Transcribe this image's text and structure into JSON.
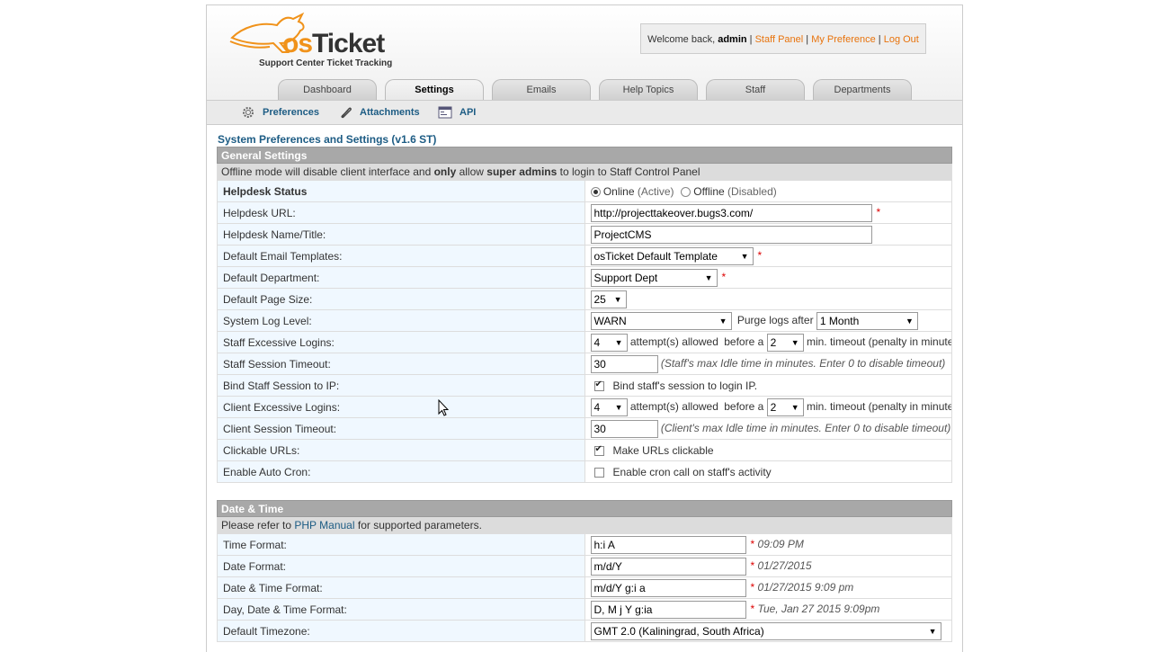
{
  "header": {
    "logo_os": "os",
    "logo_ticket": "Ticket",
    "logo_subtitle": "Support Center Ticket Tracking",
    "welcome_text": "Welcome back,",
    "username": "admin",
    "links": [
      "Staff Panel",
      "My Preference",
      "Log Out"
    ]
  },
  "tabs": [
    "Dashboard",
    "Settings",
    "Emails",
    "Help Topics",
    "Staff",
    "Departments"
  ],
  "active_tab": "Settings",
  "subnav": [
    "Preferences",
    "Attachments",
    "API"
  ],
  "page_title": "System Preferences and Settings  (v1.6 ST)",
  "general": {
    "heading": "General Settings",
    "info_pre": "Offline mode will disable client interface and ",
    "info_only": "only",
    "info_mid": " allow ",
    "info_super": "super admins",
    "info_post": " to login to Staff Control Panel",
    "helpdesk_status": {
      "label": "Helpdesk Status",
      "online": "Online",
      "online_hint": "(Active)",
      "offline": "Offline",
      "offline_hint": "(Disabled)"
    },
    "helpdesk_url": {
      "label": "Helpdesk URL:",
      "value": "http://projecttakeover.bugs3.com/"
    },
    "helpdesk_name": {
      "label": "Helpdesk Name/Title:",
      "value": "ProjectCMS"
    },
    "email_templates": {
      "label": "Default Email Templates:",
      "value": "osTicket Default Template"
    },
    "department": {
      "label": "Default Department:",
      "value": "Support Dept"
    },
    "page_size": {
      "label": "Default Page Size:",
      "value": "25"
    },
    "log_level": {
      "label": "System Log Level:",
      "value": "WARN",
      "purge_label": "Purge logs after",
      "purge_value": "1 Month"
    },
    "staff_logins": {
      "label": "Staff Excessive Logins:",
      "attempts": "4",
      "attempts_text": "attempt(s) allowed",
      "before_text": "before a",
      "timeout": "2",
      "timeout_text": "min. timeout (penalty in minutes)"
    },
    "staff_session": {
      "label": "Staff Session Timeout:",
      "value": "30",
      "hint": "(Staff's max Idle time in minutes. Enter 0 to disable timeout)"
    },
    "bind_ip": {
      "label": "Bind Staff Session to IP:",
      "text": "Bind staff's session to login IP."
    },
    "client_logins": {
      "label": "Client Excessive Logins:",
      "attempts": "4",
      "attempts_text": "attempt(s) allowed",
      "before_text": "before a",
      "timeout": "2",
      "timeout_text": "min. timeout (penalty in minutes)"
    },
    "client_session": {
      "label": "Client Session Timeout:",
      "value": "30",
      "hint": "(Client's max Idle time in minutes. Enter 0 to disable timeout)"
    },
    "clickable_urls": {
      "label": "Clickable URLs:",
      "text": "Make URLs clickable"
    },
    "auto_cron": {
      "label": "Enable Auto Cron:",
      "text": "Enable cron call on staff's activity"
    }
  },
  "datetime": {
    "heading": "Date & Time",
    "info_pre": "Please refer to ",
    "info_link": "PHP Manual",
    "info_post": " for supported parameters.",
    "time_format": {
      "label": "Time Format:",
      "value": "h:i A",
      "example": "09:09 PM"
    },
    "date_format": {
      "label": "Date Format:",
      "value": "m/d/Y",
      "example": "01/27/2015"
    },
    "datetime_format": {
      "label": "Date & Time Format:",
      "value": "m/d/Y g:i a",
      "example": "01/27/2015 9:09 pm"
    },
    "daydatetime_format": {
      "label": "Day, Date & Time Format:",
      "value": "D, M j Y g:ia",
      "example": "Tue, Jan 27 2015 9:09pm"
    },
    "timezone": {
      "label": "Default Timezone:",
      "value": "GMT 2.0 (Kaliningrad, South Africa)"
    }
  },
  "required_mark": "*"
}
